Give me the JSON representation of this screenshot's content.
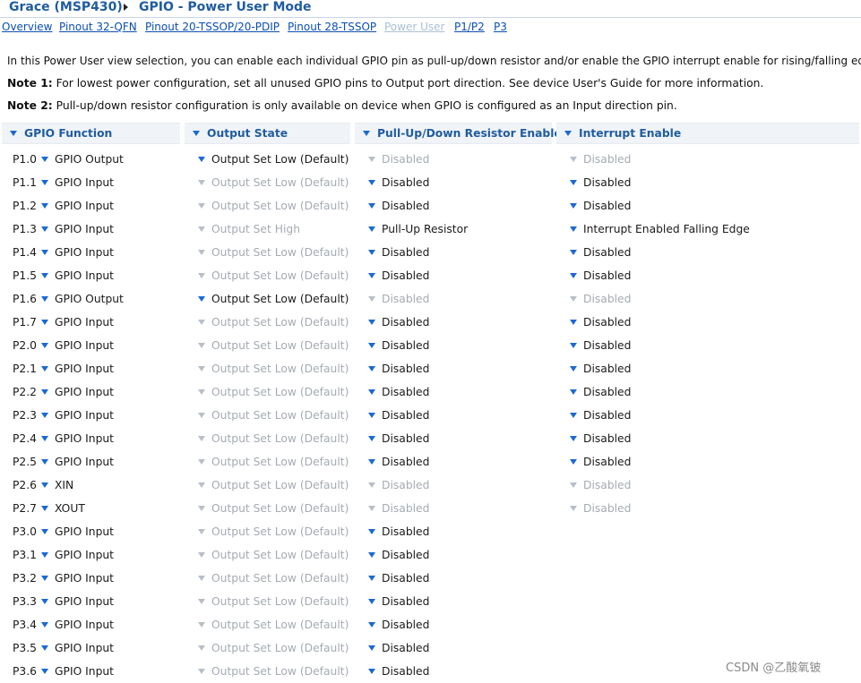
{
  "breadcrumb": {
    "root": "Grace (MSP430)",
    "page": "GPIO - Power User Mode"
  },
  "nav_links": [
    {
      "label": "Overview",
      "enabled": true
    },
    {
      "label": "Pinout 32-QFN",
      "enabled": true
    },
    {
      "label": "Pinout 20-TSSOP/20-PDIP",
      "enabled": true
    },
    {
      "label": "Pinout 28-TSSOP",
      "enabled": true
    },
    {
      "label": "Power User",
      "enabled": false
    },
    {
      "label": "P1/P2",
      "enabled": true
    },
    {
      "label": "P3",
      "enabled": true
    }
  ],
  "info": {
    "intro": "In this Power User view selection, you can enable each individual GPIO pin as pull-up/down resistor and/or enable the GPIO interrupt enable for rising/falling edge.",
    "note1_label": "Note 1:",
    "note1_text": "For lowest power configuration, set all unused GPIO pins to Output port direction. See device User's Guide for more information.",
    "note2_label": "Note 2:",
    "note2_text": "Pull-up/down resistor configuration is only available on device when GPIO is configured as an Input direction pin."
  },
  "columns": [
    "GPIO Function",
    "Output State",
    "Pull-Up/Down Resistor Enable",
    "Interrupt Enable"
  ],
  "rows": [
    {
      "pin": "P1.0",
      "func": "GPIO Output",
      "out": "Output Set Low (Default)",
      "out_on": true,
      "pull": "Disabled",
      "pull_on": false,
      "irq": "Disabled",
      "irq_on": false
    },
    {
      "pin": "P1.1",
      "func": "GPIO Input",
      "out": "Output Set Low (Default)",
      "out_on": false,
      "pull": "Disabled",
      "pull_on": true,
      "irq": "Disabled",
      "irq_on": true
    },
    {
      "pin": "P1.2",
      "func": "GPIO Input",
      "out": "Output Set Low (Default)",
      "out_on": false,
      "pull": "Disabled",
      "pull_on": true,
      "irq": "Disabled",
      "irq_on": true
    },
    {
      "pin": "P1.3",
      "func": "GPIO Input",
      "out": "Output Set High",
      "out_on": false,
      "pull": "Pull-Up Resistor",
      "pull_on": true,
      "irq": "Interrupt Enabled Falling Edge",
      "irq_on": true
    },
    {
      "pin": "P1.4",
      "func": "GPIO Input",
      "out": "Output Set Low (Default)",
      "out_on": false,
      "pull": "Disabled",
      "pull_on": true,
      "irq": "Disabled",
      "irq_on": true
    },
    {
      "pin": "P1.5",
      "func": "GPIO Input",
      "out": "Output Set Low (Default)",
      "out_on": false,
      "pull": "Disabled",
      "pull_on": true,
      "irq": "Disabled",
      "irq_on": true
    },
    {
      "pin": "P1.6",
      "func": "GPIO Output",
      "out": "Output Set Low (Default)",
      "out_on": true,
      "pull": "Disabled",
      "pull_on": false,
      "irq": "Disabled",
      "irq_on": false
    },
    {
      "pin": "P1.7",
      "func": "GPIO Input",
      "out": "Output Set Low (Default)",
      "out_on": false,
      "pull": "Disabled",
      "pull_on": true,
      "irq": "Disabled",
      "irq_on": true
    },
    {
      "pin": "P2.0",
      "func": "GPIO Input",
      "out": "Output Set Low (Default)",
      "out_on": false,
      "pull": "Disabled",
      "pull_on": true,
      "irq": "Disabled",
      "irq_on": true
    },
    {
      "pin": "P2.1",
      "func": "GPIO Input",
      "out": "Output Set Low (Default)",
      "out_on": false,
      "pull": "Disabled",
      "pull_on": true,
      "irq": "Disabled",
      "irq_on": true
    },
    {
      "pin": "P2.2",
      "func": "GPIO Input",
      "out": "Output Set Low (Default)",
      "out_on": false,
      "pull": "Disabled",
      "pull_on": true,
      "irq": "Disabled",
      "irq_on": true
    },
    {
      "pin": "P2.3",
      "func": "GPIO Input",
      "out": "Output Set Low (Default)",
      "out_on": false,
      "pull": "Disabled",
      "pull_on": true,
      "irq": "Disabled",
      "irq_on": true
    },
    {
      "pin": "P2.4",
      "func": "GPIO Input",
      "out": "Output Set Low (Default)",
      "out_on": false,
      "pull": "Disabled",
      "pull_on": true,
      "irq": "Disabled",
      "irq_on": true
    },
    {
      "pin": "P2.5",
      "func": "GPIO Input",
      "out": "Output Set Low (Default)",
      "out_on": false,
      "pull": "Disabled",
      "pull_on": true,
      "irq": "Disabled",
      "irq_on": true
    },
    {
      "pin": "P2.6",
      "func": "XIN",
      "out": "Output Set Low (Default)",
      "out_on": false,
      "pull": "Disabled",
      "pull_on": false,
      "irq": "Disabled",
      "irq_on": false
    },
    {
      "pin": "P2.7",
      "func": "XOUT",
      "out": "Output Set Low (Default)",
      "out_on": false,
      "pull": "Disabled",
      "pull_on": false,
      "irq": "Disabled",
      "irq_on": false
    },
    {
      "pin": "P3.0",
      "func": "GPIO Input",
      "out": "Output Set Low (Default)",
      "out_on": false,
      "pull": "Disabled",
      "pull_on": true,
      "irq": "",
      "irq_on": false
    },
    {
      "pin": "P3.1",
      "func": "GPIO Input",
      "out": "Output Set Low (Default)",
      "out_on": false,
      "pull": "Disabled",
      "pull_on": true,
      "irq": "",
      "irq_on": false
    },
    {
      "pin": "P3.2",
      "func": "GPIO Input",
      "out": "Output Set Low (Default)",
      "out_on": false,
      "pull": "Disabled",
      "pull_on": true,
      "irq": "",
      "irq_on": false
    },
    {
      "pin": "P3.3",
      "func": "GPIO Input",
      "out": "Output Set Low (Default)",
      "out_on": false,
      "pull": "Disabled",
      "pull_on": true,
      "irq": "",
      "irq_on": false
    },
    {
      "pin": "P3.4",
      "func": "GPIO Input",
      "out": "Output Set Low (Default)",
      "out_on": false,
      "pull": "Disabled",
      "pull_on": true,
      "irq": "",
      "irq_on": false
    },
    {
      "pin": "P3.5",
      "func": "GPIO Input",
      "out": "Output Set Low (Default)",
      "out_on": false,
      "pull": "Disabled",
      "pull_on": true,
      "irq": "",
      "irq_on": false
    },
    {
      "pin": "P3.6",
      "func": "GPIO Input",
      "out": "Output Set Low (Default)",
      "out_on": false,
      "pull": "Disabled",
      "pull_on": true,
      "irq": "",
      "irq_on": false
    }
  ],
  "watermark": "CSDN @乙酸氧铍",
  "colors": {
    "title": "#1f5c9f",
    "link": "#0b4fb0",
    "link_disabled": "#a9bfd6",
    "triangle_active": "#1a6ad1",
    "triangle_disabled": "#b8bec6",
    "text_disabled": "#a5abb3"
  }
}
